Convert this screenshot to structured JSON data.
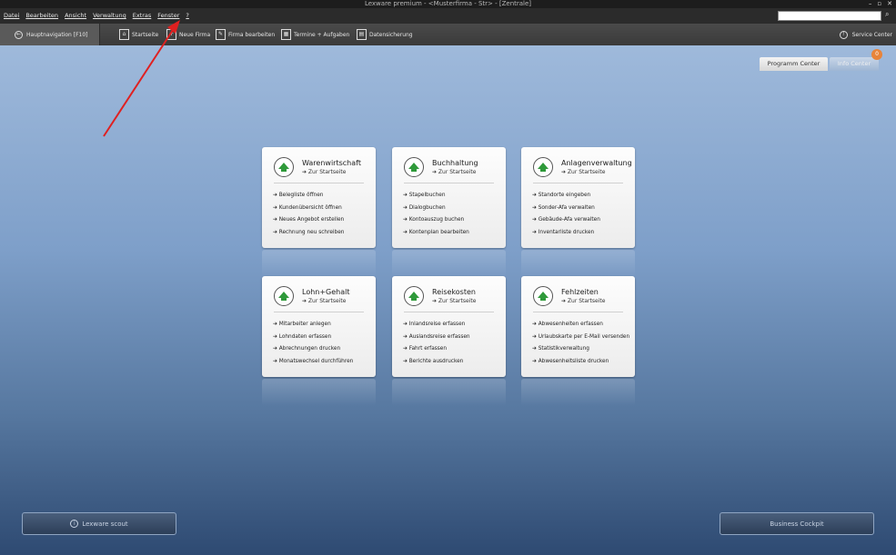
{
  "window": {
    "title": "Lexware premium - <Musterfirma - Str> - [Zentrale]",
    "controls": [
      "–",
      "▫",
      "✕"
    ]
  },
  "menu": {
    "items": [
      "Datei",
      "Bearbeiten",
      "Ansicht",
      "Verwaltung",
      "Extras",
      "Fenster",
      "?"
    ]
  },
  "search": {
    "icon": "search-icon",
    "value": ""
  },
  "toolbar": {
    "nav_label": "Hauptnavigation [F10]",
    "items": [
      {
        "label": "Startseite",
        "icon": "home-icon"
      },
      {
        "label": "Neue Firma",
        "icon": "new-company-icon"
      },
      {
        "label": "Firma bearbeiten",
        "icon": "edit-icon"
      },
      {
        "label": "Termine + Aufgaben",
        "icon": "calendar-icon"
      },
      {
        "label": "Datensicherung",
        "icon": "backup-icon"
      }
    ],
    "service_label": "Service Center"
  },
  "tabs": [
    {
      "label": "Programm Center",
      "active": true
    },
    {
      "label": "Info Center",
      "active": false,
      "badge": "0"
    }
  ],
  "cards": [
    {
      "title": "Warenwirtschaft",
      "sub": "➔ Zur Startseite",
      "links": [
        "➔ Belegliste öffnen",
        "➔ Kundenübersicht öffnen",
        "➔ Neues Angebot erstellen",
        "➔ Rechnung neu schreiben"
      ]
    },
    {
      "title": "Buchhaltung",
      "sub": "➔ Zur Startseite",
      "links": [
        "➔ Stapelbuchen",
        "➔ Dialogbuchen",
        "➔ Kontoauszug buchen",
        "➔ Kontenplan bearbeiten"
      ]
    },
    {
      "title": "Anlagenverwaltung",
      "sub": "➔ Zur Startseite",
      "links": [
        "➔ Standorte eingeben",
        "➔ Sonder-Afa verwalten",
        "➔ Gebäude-Afa verwalten",
        "➔ Inventarliste drucken"
      ]
    },
    {
      "title": "Lohn+Gehalt",
      "sub": "➔ Zur Startseite",
      "links": [
        "➔ Mitarbeiter anlegen",
        "➔ Lohndaten erfassen",
        "➔ Abrechnungen drucken",
        "➔ Monatswechsel durchführen"
      ]
    },
    {
      "title": "Reisekosten",
      "sub": "➔ Zur Startseite",
      "links": [
        "➔ Inlandsreise erfassen",
        "➔ Auslandsreise erfassen",
        "➔ Fahrt erfassen",
        "➔ Berichte ausdrucken"
      ]
    },
    {
      "title": "Fehlzeiten",
      "sub": "➔ Zur Startseite",
      "links": [
        "➔ Abwesenheiten erfassen",
        "➔ Urlaubskarte per E-Mail versenden",
        "➔ Statistikverwaltung",
        "➔ Abwesenheitsliste drucken"
      ]
    }
  ],
  "bottom": {
    "scout_label": "Lexware scout",
    "cockpit_label": "Business Cockpit"
  },
  "colors": {
    "arrow": "#e02020",
    "card_icon": "#2f9a3a",
    "badge": "#e8843a"
  }
}
